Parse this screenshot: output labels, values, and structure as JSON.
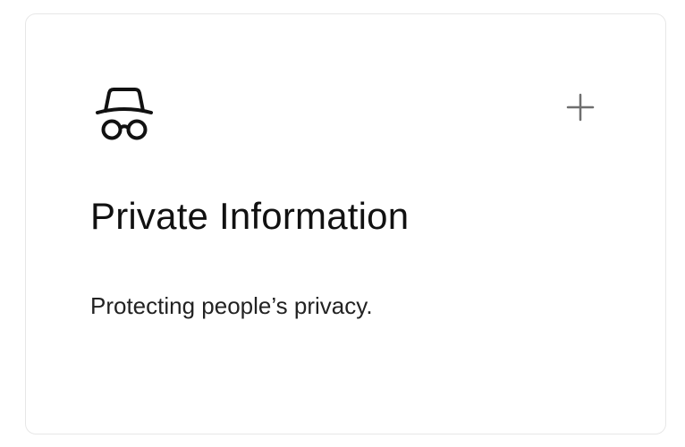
{
  "card": {
    "icon": "incognito-icon",
    "title": "Private Information",
    "description": "Protecting people’s privacy.",
    "expand_icon": "plus-icon"
  },
  "colors": {
    "text": "#111111",
    "icon": "#111111",
    "plus_icon": "#6f6f6f",
    "border": "#e7e7e7",
    "background": "#ffffff"
  }
}
